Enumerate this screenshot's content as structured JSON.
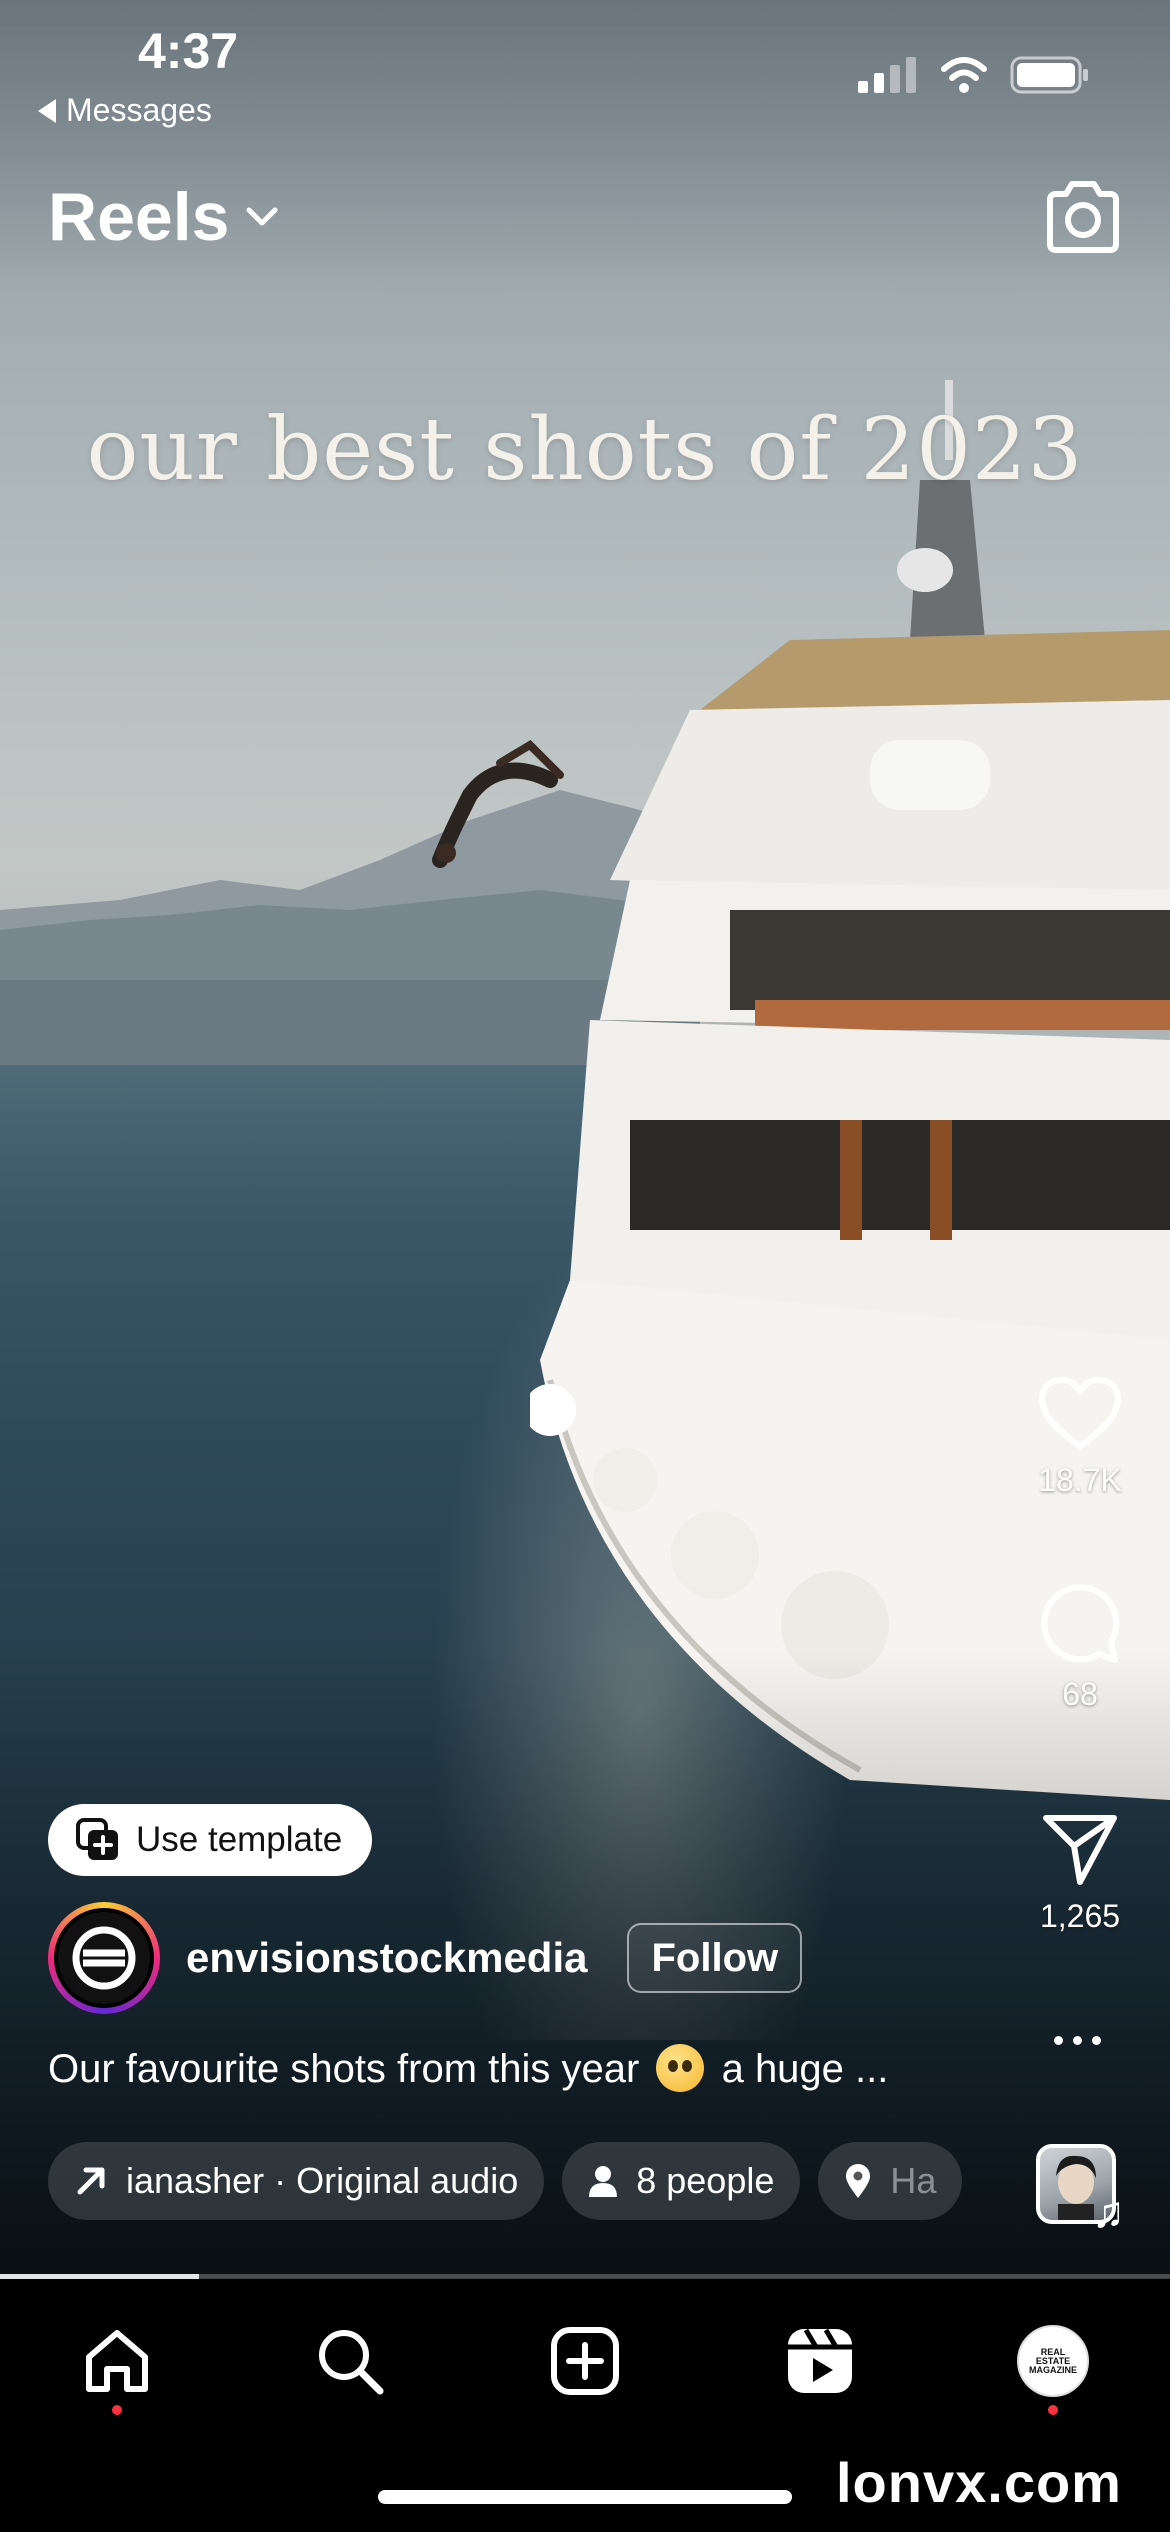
{
  "status_bar": {
    "time": "4:37",
    "back_label": "Messages",
    "icons": [
      "cellular-signal-icon",
      "wifi-icon",
      "battery-icon"
    ]
  },
  "header": {
    "title": "Reels",
    "dropdown_icon": "chevron-down-icon",
    "camera_icon": "camera-icon"
  },
  "video": {
    "overlay_text": "our best shots of 2023"
  },
  "actions": {
    "like_count": "18.7K",
    "comment_count": "68",
    "share_count": "1,265",
    "more_icon": "more-horizontal-icon"
  },
  "template_button": {
    "label": "Use template"
  },
  "author": {
    "username": "envisionstockmedia",
    "follow_label": "Follow"
  },
  "caption": {
    "text_before": "Our favourite shots from this year",
    "emoji": "pleading-face-emoji",
    "text_after": "a huge ..."
  },
  "chips": {
    "audio": "ianasher · Original audio",
    "people": "8 people",
    "location": "Ha"
  },
  "progress": {
    "fraction": 0.17
  },
  "nav": {
    "items": [
      "home-icon",
      "search-icon",
      "create-icon",
      "reels-icon",
      "profile-avatar"
    ],
    "profile_avatar_text": [
      "REAL",
      "ESTATE",
      "MAGAZINE"
    ]
  },
  "watermark": "lonvx.com",
  "colors": {
    "notification_dot": "#ff3040",
    "nav_background": "#000000"
  }
}
